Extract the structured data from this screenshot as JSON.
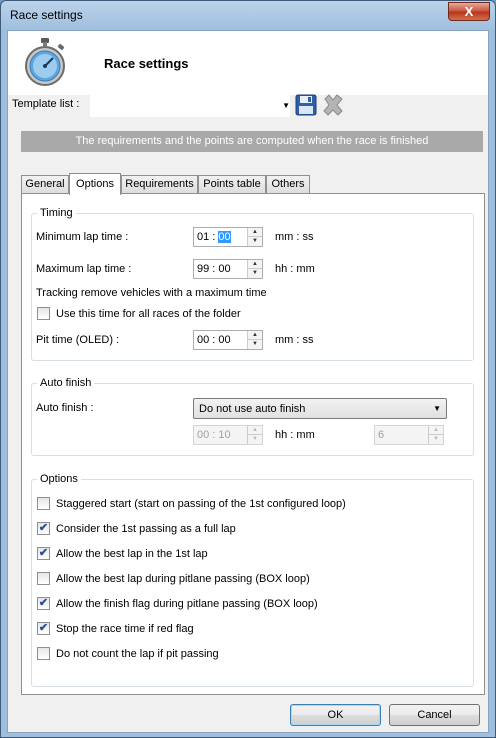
{
  "window": {
    "title": "Race settings",
    "close_label": "X"
  },
  "header": {
    "title": "Race settings"
  },
  "template": {
    "label": "Template list :",
    "value": ""
  },
  "info_bar": "The requirements and the points are computed when the race is finished",
  "tabs": [
    {
      "label": "General",
      "active": false
    },
    {
      "label": "Options",
      "active": true
    },
    {
      "label": "Requirements",
      "active": false
    },
    {
      "label": "Points table",
      "active": false
    },
    {
      "label": "Others",
      "active": false
    }
  ],
  "timing": {
    "legend": "Timing",
    "min_lap_label": "Minimum lap time :",
    "min_lap_value_a": "01 : ",
    "min_lap_value_b": "00",
    "min_lap_unit": "mm : ss",
    "max_lap_label": "Maximum lap time :",
    "max_lap_value": "99 : 00",
    "max_lap_unit": "hh : mm",
    "tracking_text": "Tracking remove vehicles with a maximum time",
    "use_time_label": "Use this time for all races of the folder",
    "use_time_checked": false,
    "pit_label": "Pit time (OLED) :",
    "pit_value": "00 : 00",
    "pit_unit": "mm : ss"
  },
  "auto_finish": {
    "legend": "Auto finish",
    "label": "Auto finish :",
    "selected": "Do not use auto finish",
    "time_value": "00 : 10",
    "time_unit": "hh : mm",
    "count_value": "6"
  },
  "options": {
    "legend": "Options",
    "items": [
      {
        "label": "Staggered start (start on passing of the 1st configured loop)",
        "checked": false
      },
      {
        "label": "Consider the 1st passing as a full lap",
        "checked": true
      },
      {
        "label": "Allow the best lap in the 1st lap",
        "checked": true
      },
      {
        "label": "Allow the best lap during pitlane passing (BOX loop)",
        "checked": false
      },
      {
        "label": "Allow the finish flag during pitlane passing (BOX loop)",
        "checked": true
      },
      {
        "label": "Stop the race time if red flag",
        "checked": true
      },
      {
        "label": "Do not count the lap if pit passing",
        "checked": false
      }
    ]
  },
  "buttons": {
    "ok": "OK",
    "cancel": "Cancel"
  },
  "checkmark_glyph": "✔",
  "colors": {
    "info_bar": "#a9a9a9",
    "selection": "#3399ff",
    "close_button": "#c7513b"
  }
}
